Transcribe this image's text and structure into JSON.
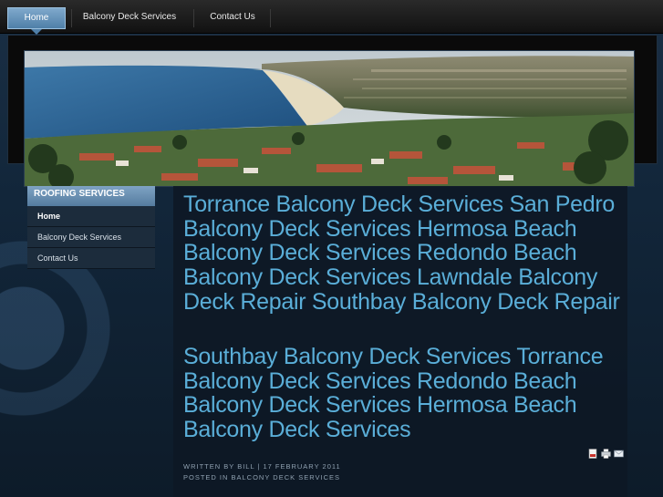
{
  "topnav": {
    "items": [
      {
        "label": "Home",
        "active": true
      },
      {
        "label": "Balcony Deck Services",
        "active": false
      },
      {
        "label": "Contact Us",
        "active": false
      }
    ]
  },
  "hero": {
    "icon": "coastline-photo"
  },
  "sidebar": {
    "title": "ROOFING SERVICES",
    "items": [
      {
        "label": "Home"
      },
      {
        "label": "Balcony Deck Services"
      },
      {
        "label": "Contact Us"
      }
    ]
  },
  "article": {
    "heading1": "Torrance Balcony Deck Services San Pedro Balcony Deck Services Hermosa Beach Balcony Deck Services Redondo Beach Balcony Deck Services Lawndale Balcony Deck Repair Southbay Balcony Deck Repair",
    "heading2": "Southbay Balcony Deck Services Torrance Balcony Deck Services Redondo Beach Balcony Deck Services Hermosa Beach Balcony Deck Services",
    "meta_written": "WRITTEN BY BILL | 17 FEBRUARY 2011",
    "meta_posted": "POSTED IN BALCONY DECK SERVICES",
    "icons": [
      "pdf-icon",
      "print-icon",
      "email-icon"
    ]
  },
  "colors": {
    "accent": "#5aaed8",
    "nav_active": "#6f9dc3",
    "sidebar_title": "#6b91b3"
  }
}
